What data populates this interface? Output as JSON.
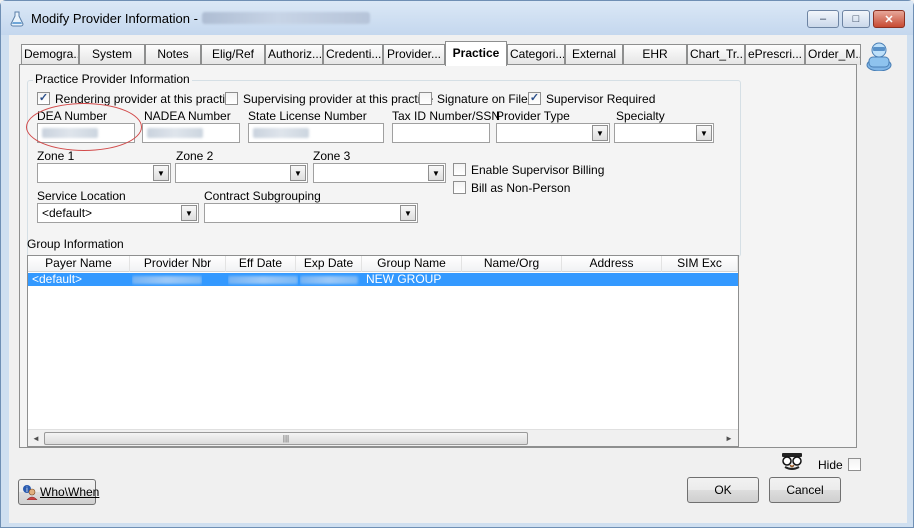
{
  "window": {
    "title": "Modify Provider Information -",
    "minimize_glyph": "–",
    "maximize_glyph": "□",
    "close_glyph": "✕"
  },
  "tabs": [
    {
      "label": "Demogra..."
    },
    {
      "label": "System"
    },
    {
      "label": "Notes"
    },
    {
      "label": "Elig/Ref"
    },
    {
      "label": "Authoriz..."
    },
    {
      "label": "Credenti..."
    },
    {
      "label": "Provider..."
    },
    {
      "label": "Practice"
    },
    {
      "label": "Categori..."
    },
    {
      "label": "External"
    },
    {
      "label": "EHR"
    },
    {
      "label": "Chart_Tr..."
    },
    {
      "label": "ePrescri..."
    },
    {
      "label": "Order_M..."
    }
  ],
  "active_tab": "Practice",
  "practice": {
    "group_title": "Practice Provider Information",
    "checks": {
      "rendering": {
        "label": "Rendering provider at this practice",
        "checked": true
      },
      "supervising": {
        "label": "Supervising provider at this practice",
        "checked": false
      },
      "signature": {
        "label": "Signature on File",
        "checked": false
      },
      "supervisor_required": {
        "label": "Supervisor Required",
        "checked": true
      },
      "enable_supervisor_billing": {
        "label": "Enable Supervisor Billing",
        "checked": false
      },
      "bill_non_person": {
        "label": "Bill as Non-Person",
        "checked": false
      }
    },
    "fields": {
      "dea_label": "DEA Number",
      "nadea_label": "NADEA Number",
      "state_license_label": "State License Number",
      "tax_id_label": "Tax ID Number/SSN",
      "tax_id_value": "",
      "provider_type_label": "Provider Type",
      "provider_type_value": "",
      "specialty_label": "Specialty",
      "specialty_value": "",
      "zone1_label": "Zone 1",
      "zone1_value": "",
      "zone2_label": "Zone 2",
      "zone2_value": "",
      "zone3_label": "Zone 3",
      "zone3_value": "",
      "service_location_label": "Service Location",
      "service_location_value": "<default>",
      "contract_subgrouping_label": "Contract Subgrouping",
      "contract_subgrouping_value": ""
    }
  },
  "group_info": {
    "title": "Group Information",
    "columns": [
      "Payer Name",
      "Provider Nbr",
      "Eff Date",
      "Exp Date",
      "Group Name",
      "Name/Org",
      "Address",
      "SIM Exc"
    ],
    "rows": [
      {
        "payer_name": "<default>",
        "group_name": "NEW GROUP"
      }
    ],
    "scroll_left": "◄",
    "scroll_right": "►",
    "scroll_grip": "|||"
  },
  "footer": {
    "hide_label": "Hide",
    "hide_checked": false,
    "who_when_label": "Who\\When",
    "ok_label": "OK",
    "cancel_label": "Cancel"
  },
  "dropdown_glyph": "▼",
  "check_glyph": "✓"
}
